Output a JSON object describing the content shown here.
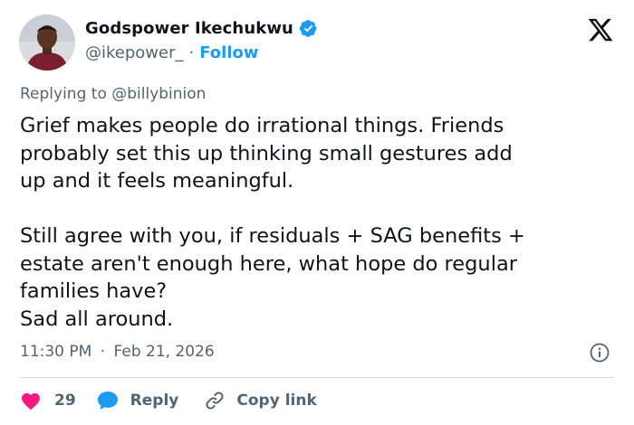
{
  "author": {
    "display_name": "Godspower Ikechukwu",
    "handle": "@ikepower_",
    "separator": "·",
    "follow_label": "Follow",
    "verified": true
  },
  "reply_context": {
    "prefix": "Replying to",
    "mention": "@billybinion"
  },
  "tweet": {
    "text": "Grief makes people do irrational things. Friends\nprobably set this up thinking small gestures add\nup and it feels meaningful.\n\nStill agree with you, if residuals + SAG benefits +\nestate aren't enough here, what hope do regular\nfamilies have?\nSad all around.",
    "time": "11:30 PM",
    "separator": "·",
    "date": "Feb 21, 2026"
  },
  "actions": {
    "like_count": "29",
    "reply_label": "Reply",
    "copy_label": "Copy link"
  },
  "icons": {
    "logo": "x-logo-icon",
    "verified": "verified-badge-icon",
    "info": "info-icon",
    "like": "heart-icon",
    "reply": "speech-bubble-icon",
    "copy": "link-icon"
  },
  "colors": {
    "accent": "#1d9bf0",
    "text": "#0f1419",
    "muted": "#536471",
    "like": "#f91880",
    "divider": "#cfd9de"
  }
}
